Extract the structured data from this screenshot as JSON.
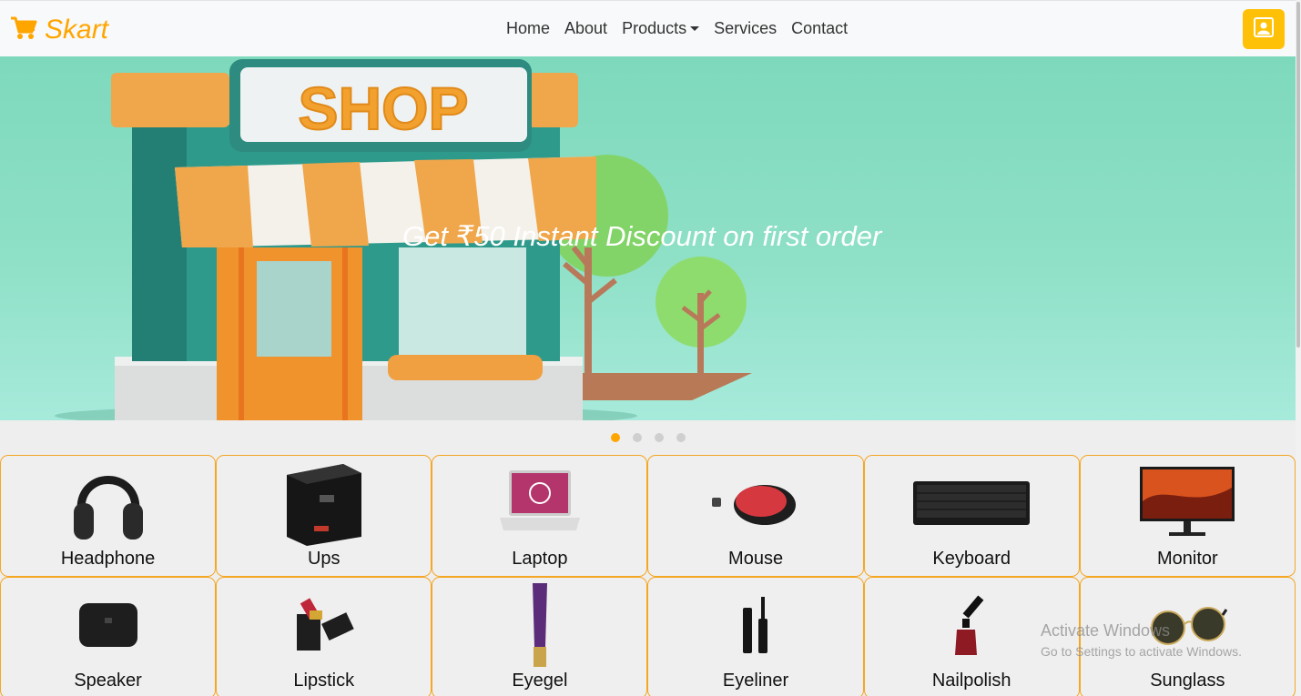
{
  "brand": {
    "name": "Skart",
    "icon": "cart-icon",
    "color": "#ffa500"
  },
  "nav": {
    "links": [
      "Home",
      "About",
      "Products",
      "Services",
      "Contact"
    ],
    "account_icon": "user-icon",
    "account_color": "#ffc107"
  },
  "hero": {
    "sign_text": "SHOP",
    "caption": "Get ₹50 Instant Discount on first order",
    "slides": 4,
    "active_slide": 1
  },
  "products": [
    {
      "label": "Headphone",
      "icon": "headphone-icon"
    },
    {
      "label": "Ups",
      "icon": "ups-icon"
    },
    {
      "label": "Laptop",
      "icon": "laptop-icon"
    },
    {
      "label": "Mouse",
      "icon": "mouse-icon"
    },
    {
      "label": "Keyboard",
      "icon": "keyboard-icon"
    },
    {
      "label": "Monitor",
      "icon": "monitor-icon"
    },
    {
      "label": "Speaker",
      "icon": "speaker-icon"
    },
    {
      "label": "Lipstick",
      "icon": "lipstick-icon"
    },
    {
      "label": "Eyegel",
      "icon": "eyegel-icon"
    },
    {
      "label": "Eyeliner",
      "icon": "eyeliner-icon"
    },
    {
      "label": "Nailpolish",
      "icon": "nailpolish-icon"
    },
    {
      "label": "Sunglass",
      "icon": "sunglass-icon"
    }
  ],
  "watermark": {
    "line1": "Activate Windows",
    "line2": "Go to Settings to activate Windows."
  }
}
